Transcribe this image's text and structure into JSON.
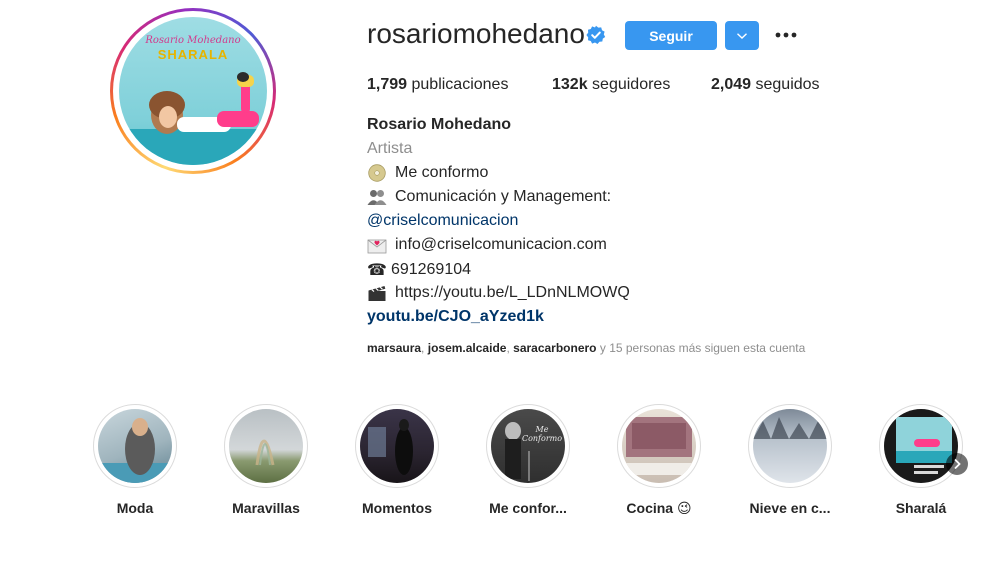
{
  "profile": {
    "username": "rosariomohedano",
    "verified_icon": "verified-badge-icon",
    "avatar_caption_line1": "Rosario Mohedano",
    "avatar_caption_line2": "SHARALA",
    "follow_label": "Seguir",
    "dropdown_icon": "chevron-down-icon",
    "more_icon": "more-options-icon",
    "accent_color": "#3897f0"
  },
  "stats": {
    "posts_count": "1,799",
    "posts_label": "publicaciones",
    "followers_count": "132k",
    "followers_label": "seguidores",
    "following_count": "2,049",
    "following_label": "seguidos"
  },
  "bio": {
    "name": "Rosario Mohedano",
    "category": "Artista",
    "line1": "Me conformo",
    "line2": "Comunicación y Management:",
    "line3": "@criselcomunicacion",
    "line4": "info@criselcomunicacion.com",
    "line5_prefix": "☎",
    "line5": "691269104",
    "line6": "https://youtu.be/L_LDnNLMOWQ",
    "link": "youtu.be/CJO_aYzed1k",
    "followed_by_user1": "marsaura",
    "followed_by_user2": "josem.alcaide",
    "followed_by_user3": "saracarbonero",
    "followed_by_rest": "y 15 personas más siguen esta cuenta",
    "sep": ","
  },
  "highlights": [
    {
      "label": "Moda"
    },
    {
      "label": "Maravillas"
    },
    {
      "label": "Momentos"
    },
    {
      "label": "Me confor..."
    },
    {
      "label": "Cocina 😉"
    },
    {
      "label": "Nieve en c..."
    },
    {
      "label": "Sharalá"
    }
  ],
  "highlight_thumb_text": "Me Conformo",
  "next_icon": "chevron-right-icon"
}
